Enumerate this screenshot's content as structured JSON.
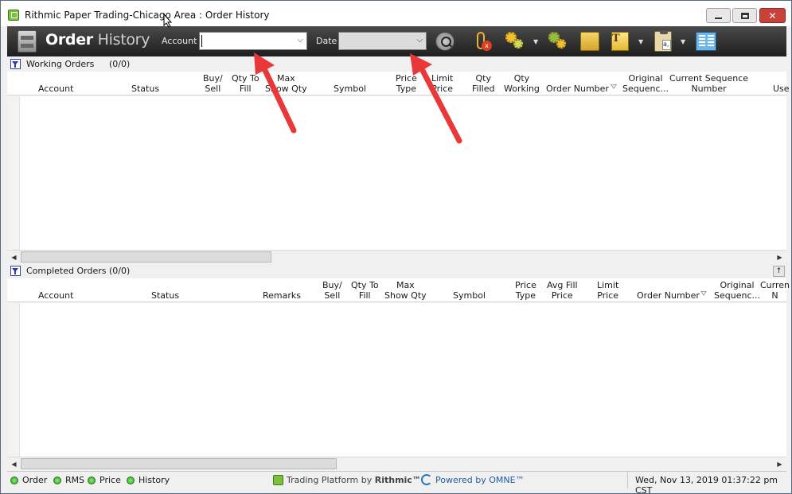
{
  "window": {
    "title": "Rithmic Paper Trading-Chicago Area : Order History",
    "close_glyph": "✕"
  },
  "toolbar": {
    "title_bold": "Order",
    "title_light": "History",
    "account_label": "Account",
    "account_value": "",
    "date_label": "Date",
    "date_value": "",
    "chevron": "⌵",
    "drop": "▼"
  },
  "working": {
    "title": "Working Orders",
    "count": "(0/0)",
    "columns": {
      "account": "Account",
      "status": "Status",
      "buy_sell": "Buy/\nSell",
      "qty_to_fill": "Qty To\nFill",
      "max_show": "Max\nShow Qty",
      "symbol": "Symbol",
      "price_type": "Price\nType",
      "limit_price": "Limit\nPrice",
      "qty_filled": "Qty\nFilled",
      "qty_working": "Qty\nWorking",
      "order_number": "Order Number",
      "original_seq": "Original\nSequenc...",
      "current_seq": "Current Sequence\nNumber",
      "user": "Use"
    }
  },
  "completed": {
    "title": "Completed Orders",
    "count": "(0/0)",
    "collapse": "↑",
    "columns": {
      "account": "Account",
      "status": "Status",
      "remarks": "Remarks",
      "buy_sell": "Buy/\nSell",
      "qty_to_fill": "Qty To\nFill",
      "max_show": "Max\nShow Qty",
      "symbol": "Symbol",
      "price_type": "Price\nType",
      "avg_fill": "Avg Fill\nPrice",
      "limit_price": "Limit\nPrice",
      "order_number": "Order Number",
      "original_seq": "Original\nSequenc...",
      "current_seq": "Curren\nN"
    }
  },
  "scroll": {
    "left": "◀",
    "right": "▶"
  },
  "status": {
    "order": "Order",
    "rms": "RMS",
    "price": "Price",
    "history": "History",
    "platform": "Trading Platform by",
    "platform_brand": "Rithmic™",
    "powered": "Powered by OMNE™",
    "datetime": "Wed, Nov 13, 2019 01:37:22 pm CST"
  },
  "colors": {
    "arrow": "#e8383a",
    "toolbar_top": "#4a4a4a",
    "toolbar_bottom": "#1e1e1e",
    "status_led": "#2a9a1a"
  }
}
